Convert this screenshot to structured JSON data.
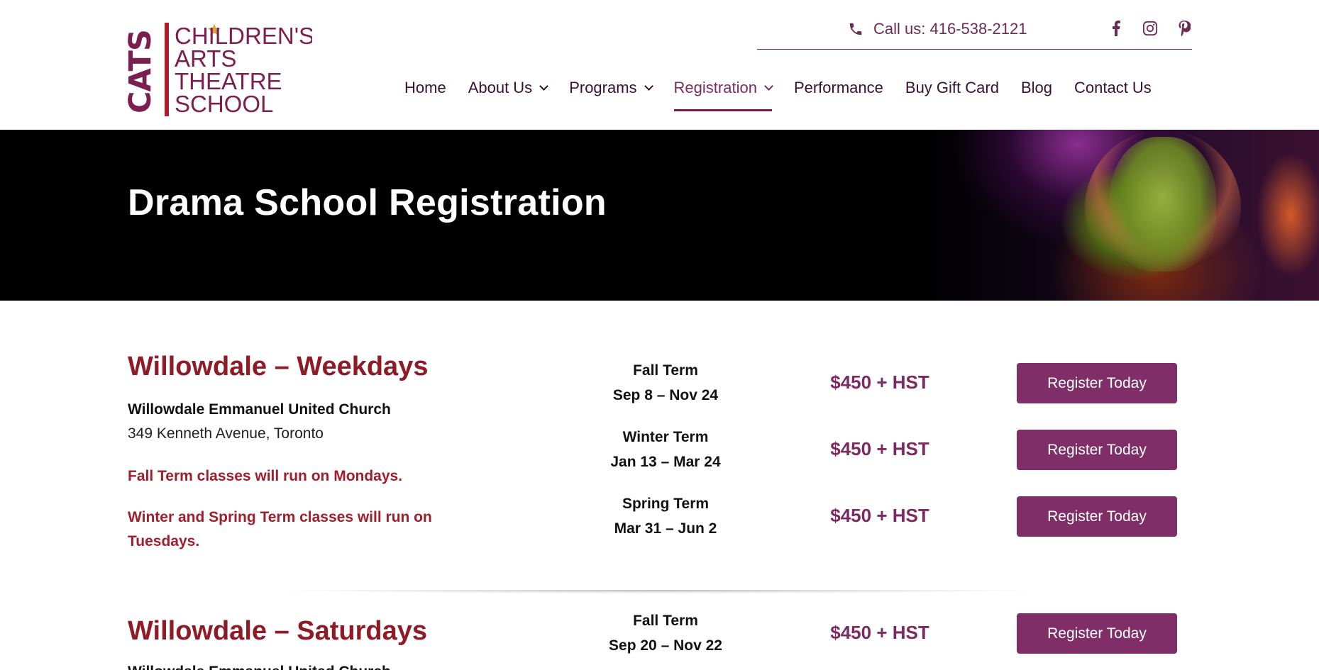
{
  "header": {
    "logo": {
      "mark": "CATS",
      "lines": [
        "CHILDREN'S",
        "ARTS",
        "THEATRE",
        "SCHOOL"
      ],
      "color": "#7a1f4f"
    },
    "phone_label": "Call us: 416-538-2121",
    "socials": [
      "facebook-icon",
      "instagram-icon",
      "pinterest-icon"
    ],
    "nav": [
      {
        "label": "Home",
        "dropdown": false,
        "active": false
      },
      {
        "label": "About Us",
        "dropdown": true,
        "active": false
      },
      {
        "label": "Programs",
        "dropdown": true,
        "active": false
      },
      {
        "label": "Registration",
        "dropdown": true,
        "active": true
      },
      {
        "label": "Performance",
        "dropdown": false,
        "active": false
      },
      {
        "label": "Buy Gift Card",
        "dropdown": false,
        "active": false
      },
      {
        "label": "Blog",
        "dropdown": false,
        "active": false
      },
      {
        "label": "Contact Us",
        "dropdown": false,
        "active": false
      }
    ]
  },
  "hero": {
    "title": "Drama School Registration"
  },
  "sections": [
    {
      "title": "Willowdale – Weekdays",
      "venue": "Willowdale Emmanuel United Church",
      "address": "349 Kenneth Avenue, Toronto",
      "notes": [
        "Fall Term classes will run on Mondays.",
        "Winter and Spring Term classes will run on Tuesdays."
      ],
      "terms": [
        {
          "name": "Fall Term",
          "dates": "Sep 8 – Nov 24",
          "price": "$450 + HST",
          "button": "Register Today"
        },
        {
          "name": "Winter Term",
          "dates": "Jan 13 – Mar 24",
          "price": "$450 + HST",
          "button": "Register Today"
        },
        {
          "name": "Spring Term",
          "dates": "Mar 31 – Jun 2",
          "price": "$450 + HST",
          "button": "Register Today"
        }
      ]
    },
    {
      "title": "Willowdale – Saturdays",
      "venue": "Willowdale Emmanuel United Church",
      "terms": [
        {
          "name": "Fall Term",
          "dates": "Sep 20 – Nov 22",
          "price": "$450 + HST",
          "button": "Register Today"
        }
      ]
    }
  ],
  "colors": {
    "brand": "#7a1f4f",
    "button": "#7f2e67",
    "heading_red": "#8e1b26",
    "note_red": "#a01e2c",
    "price": "#7d2a63"
  }
}
